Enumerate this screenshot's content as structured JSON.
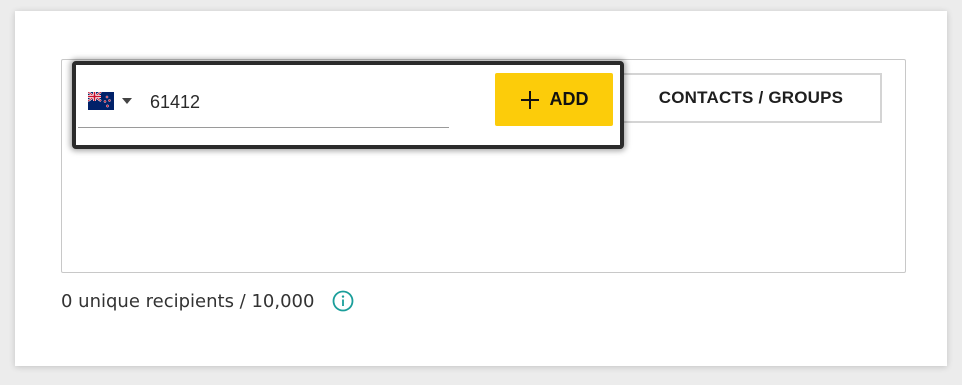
{
  "phone_entry": {
    "country_flag": "new-zealand-flag-icon",
    "number_value": "61412",
    "add_label": "ADD",
    "add_color": "#fccc0a"
  },
  "contacts_groups_label": "CONTACTS / GROUPS",
  "recipients": {
    "summary": "0 unique recipients / 10,000",
    "info_icon": "info-circle-icon",
    "info_color": "#1a9e9a"
  },
  "colors": {
    "highlight_border": "#2b2b2b",
    "accent_yellow": "#fccc0a",
    "teal": "#1a9e9a"
  }
}
